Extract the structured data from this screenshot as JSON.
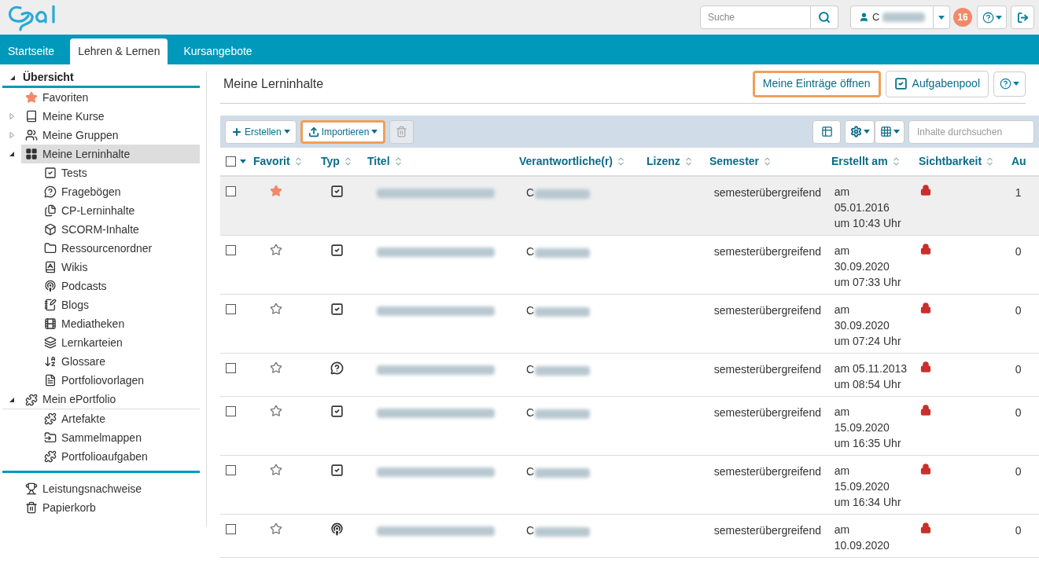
{
  "header": {
    "search": {
      "placeholder": "Suche"
    },
    "user": {
      "name": "C"
    },
    "notifications": {
      "count": "16"
    }
  },
  "tabs": [
    {
      "label": "Startseite",
      "selected": false
    },
    {
      "label": "Lehren & Lernen",
      "selected": true
    },
    {
      "label": "Kursangebote",
      "selected": false
    }
  ],
  "sidebar": {
    "header": {
      "label": "Übersicht",
      "expanded": true
    },
    "items": [
      {
        "label": "Favoriten",
        "selected": false
      },
      {
        "label": "Meine Kurse",
        "selected": false,
        "expanded": false
      },
      {
        "label": "Meine Gruppen",
        "selected": false,
        "expanded": false
      },
      {
        "label": "Meine Lerninhalte",
        "selected": true,
        "expanded": true,
        "children": [
          {
            "label": "Tests"
          },
          {
            "label": "Fragebögen"
          },
          {
            "label": "CP-Lerninhalte"
          },
          {
            "label": "SCORM-Inhalte"
          },
          {
            "label": "Ressourcenordner"
          },
          {
            "label": "Wikis"
          },
          {
            "label": "Podcasts"
          },
          {
            "label": "Blogs"
          },
          {
            "label": "Mediatheken"
          },
          {
            "label": "Lernkarteien"
          },
          {
            "label": "Glossare"
          },
          {
            "label": "Portfoliovorlagen"
          }
        ]
      },
      {
        "label": "Mein ePortfolio",
        "selected": false,
        "expanded": true,
        "children": [
          {
            "label": "Artefakte"
          },
          {
            "label": "Sammelmappen"
          },
          {
            "label": "Portfolioaufgaben"
          }
        ]
      }
    ],
    "footer_items": [
      {
        "label": "Leistungsnachweise"
      },
      {
        "label": "Papierkorb"
      }
    ]
  },
  "main": {
    "title": "Meine Lerninhalte",
    "actions": [
      {
        "label": "Meine Einträge öffnen",
        "highlighted": true
      },
      {
        "label": "Aufgabenpool",
        "highlighted": false
      }
    ],
    "toolbar": {
      "buttons": [
        {
          "label": "Erstellen",
          "highlighted": false,
          "disabled": false
        },
        {
          "label": "Importieren",
          "highlighted": true,
          "disabled": false
        },
        {
          "highlighted": false,
          "disabled": true
        }
      ],
      "search": {
        "placeholder": "Inhalte durchsuchen"
      }
    },
    "table": {
      "select_all_checked": false,
      "columns": [
        "Favorit",
        "Typ",
        "Titel",
        "Verantwortliche(r)",
        "Lizenz",
        "Semester",
        "Erstellt am",
        "Sichtbarkeit",
        "Au"
      ],
      "rows": [
        {
          "hovered": true,
          "checked": false,
          "favorite": true,
          "kind": "test",
          "responsible": "C",
          "semester": "semesterübergreifend",
          "created": [
            "am",
            "05.01.2016",
            "um 10:43 Uhr"
          ],
          "locked": true,
          "column_9": "1"
        },
        {
          "hovered": false,
          "checked": false,
          "favorite": false,
          "kind": "test",
          "responsible": "C",
          "semester": "semesterübergreifend",
          "created": [
            "am",
            "30.09.2020",
            "um 07:33 Uhr"
          ],
          "locked": true,
          "column_9": "0"
        },
        {
          "hovered": false,
          "checked": false,
          "favorite": false,
          "kind": "test",
          "responsible": "C",
          "semester": "semesterübergreifend",
          "created": [
            "am",
            "30.09.2020",
            "um 07:24 Uhr"
          ],
          "locked": true,
          "column_9": "0"
        },
        {
          "hovered": false,
          "checked": false,
          "favorite": false,
          "kind": "survey",
          "responsible": "C",
          "semester": "semesterübergreifend",
          "created": [
            "am 05.11.2013",
            "um 08:54 Uhr"
          ],
          "locked": true,
          "column_9": "0"
        },
        {
          "hovered": false,
          "checked": false,
          "favorite": false,
          "kind": "test",
          "responsible": "C",
          "semester": "semesterübergreifend",
          "created": [
            "am",
            "15.09.2020",
            "um 16:35 Uhr"
          ],
          "locked": true,
          "column_9": "0"
        },
        {
          "hovered": false,
          "checked": false,
          "favorite": false,
          "kind": "test",
          "responsible": "C",
          "semester": "semesterübergreifend",
          "created": [
            "am",
            "15.09.2020",
            "um 16:34 Uhr"
          ],
          "locked": true,
          "column_9": "0"
        },
        {
          "hovered": false,
          "checked": false,
          "favorite": false,
          "kind": "podcast",
          "responsible": "C",
          "semester": "semesterübergreifend",
          "created": [
            "am",
            "10.09.2020"
          ],
          "locked": true,
          "column_9": "0"
        }
      ]
    }
  }
}
